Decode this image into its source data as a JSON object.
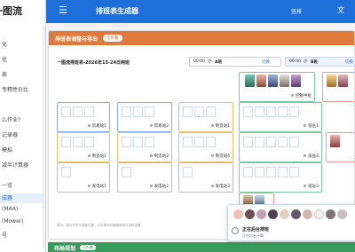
{
  "sidebar": {
    "title": "一图流",
    "items": [
      "化",
      "化",
      "表",
      "专精性价比",
      "么作业?",
      "记录器",
      "模拟",
      "减半计算器",
      "一览",
      "成器",
      "(MAA)",
      "(Mower)",
      "号"
    ],
    "active_index": 9
  },
  "topbar": {
    "menu_icon": "☰",
    "title": "排班表生成器",
    "right_label": "竖排",
    "right_icon": "文"
  },
  "card": {
    "header_title": "排班表调整与导出",
    "header_badge": "可折叠",
    "schedule_name": "一图流排班表-2026年15-24日两班",
    "time_boxes": [
      {
        "time": "00:00",
        "label": "A班",
        "button": "切换",
        "extra": ""
      },
      {
        "time": "00:00",
        "label": "B班",
        "button": "切换",
        "extra": "✓ ⊕"
      }
    ],
    "note": "提示：拖动干员可调换位置，点击房间可编辑房间与排班设置"
  },
  "rooms": [
    {
      "id": "control",
      "name": "控制中枢",
      "color": "green"
    },
    {
      "id": "trade-right",
      "name": "",
      "color": "red"
    },
    {
      "id": "trade1",
      "name": "贸易站1",
      "color": "blue"
    },
    {
      "id": "trade2",
      "name": "贸易站2",
      "color": "blue"
    },
    {
      "id": "manu1",
      "name": "制造站1",
      "color": "yellow"
    },
    {
      "id": "dorm1",
      "name": "宿舍1",
      "color": "green"
    },
    {
      "id": "manu2",
      "name": "制造站2",
      "color": "yellow"
    },
    {
      "id": "manu3",
      "name": "制造站3",
      "color": "yellow"
    },
    {
      "id": "manu4",
      "name": "制造站4",
      "color": "yellow"
    },
    {
      "id": "dorm2",
      "name": "宿舍2",
      "color": "green"
    },
    {
      "id": "dorm-right",
      "name": "",
      "color": "red"
    },
    {
      "id": "power1",
      "name": "发电站1",
      "color": "gray"
    },
    {
      "id": "power2",
      "name": "发电站2",
      "color": "gray"
    },
    {
      "id": "power3",
      "name": "发电站3",
      "color": "gray"
    },
    {
      "id": "dorm3",
      "name": "宿舍3",
      "color": "green"
    },
    {
      "id": "bottom",
      "name": "",
      "color": "red"
    }
  ],
  "section2": {
    "title": "布局规划",
    "badge": "可折叠"
  },
  "toast": {
    "title": "正在后台排班",
    "subtitle": "正在后台计算"
  }
}
